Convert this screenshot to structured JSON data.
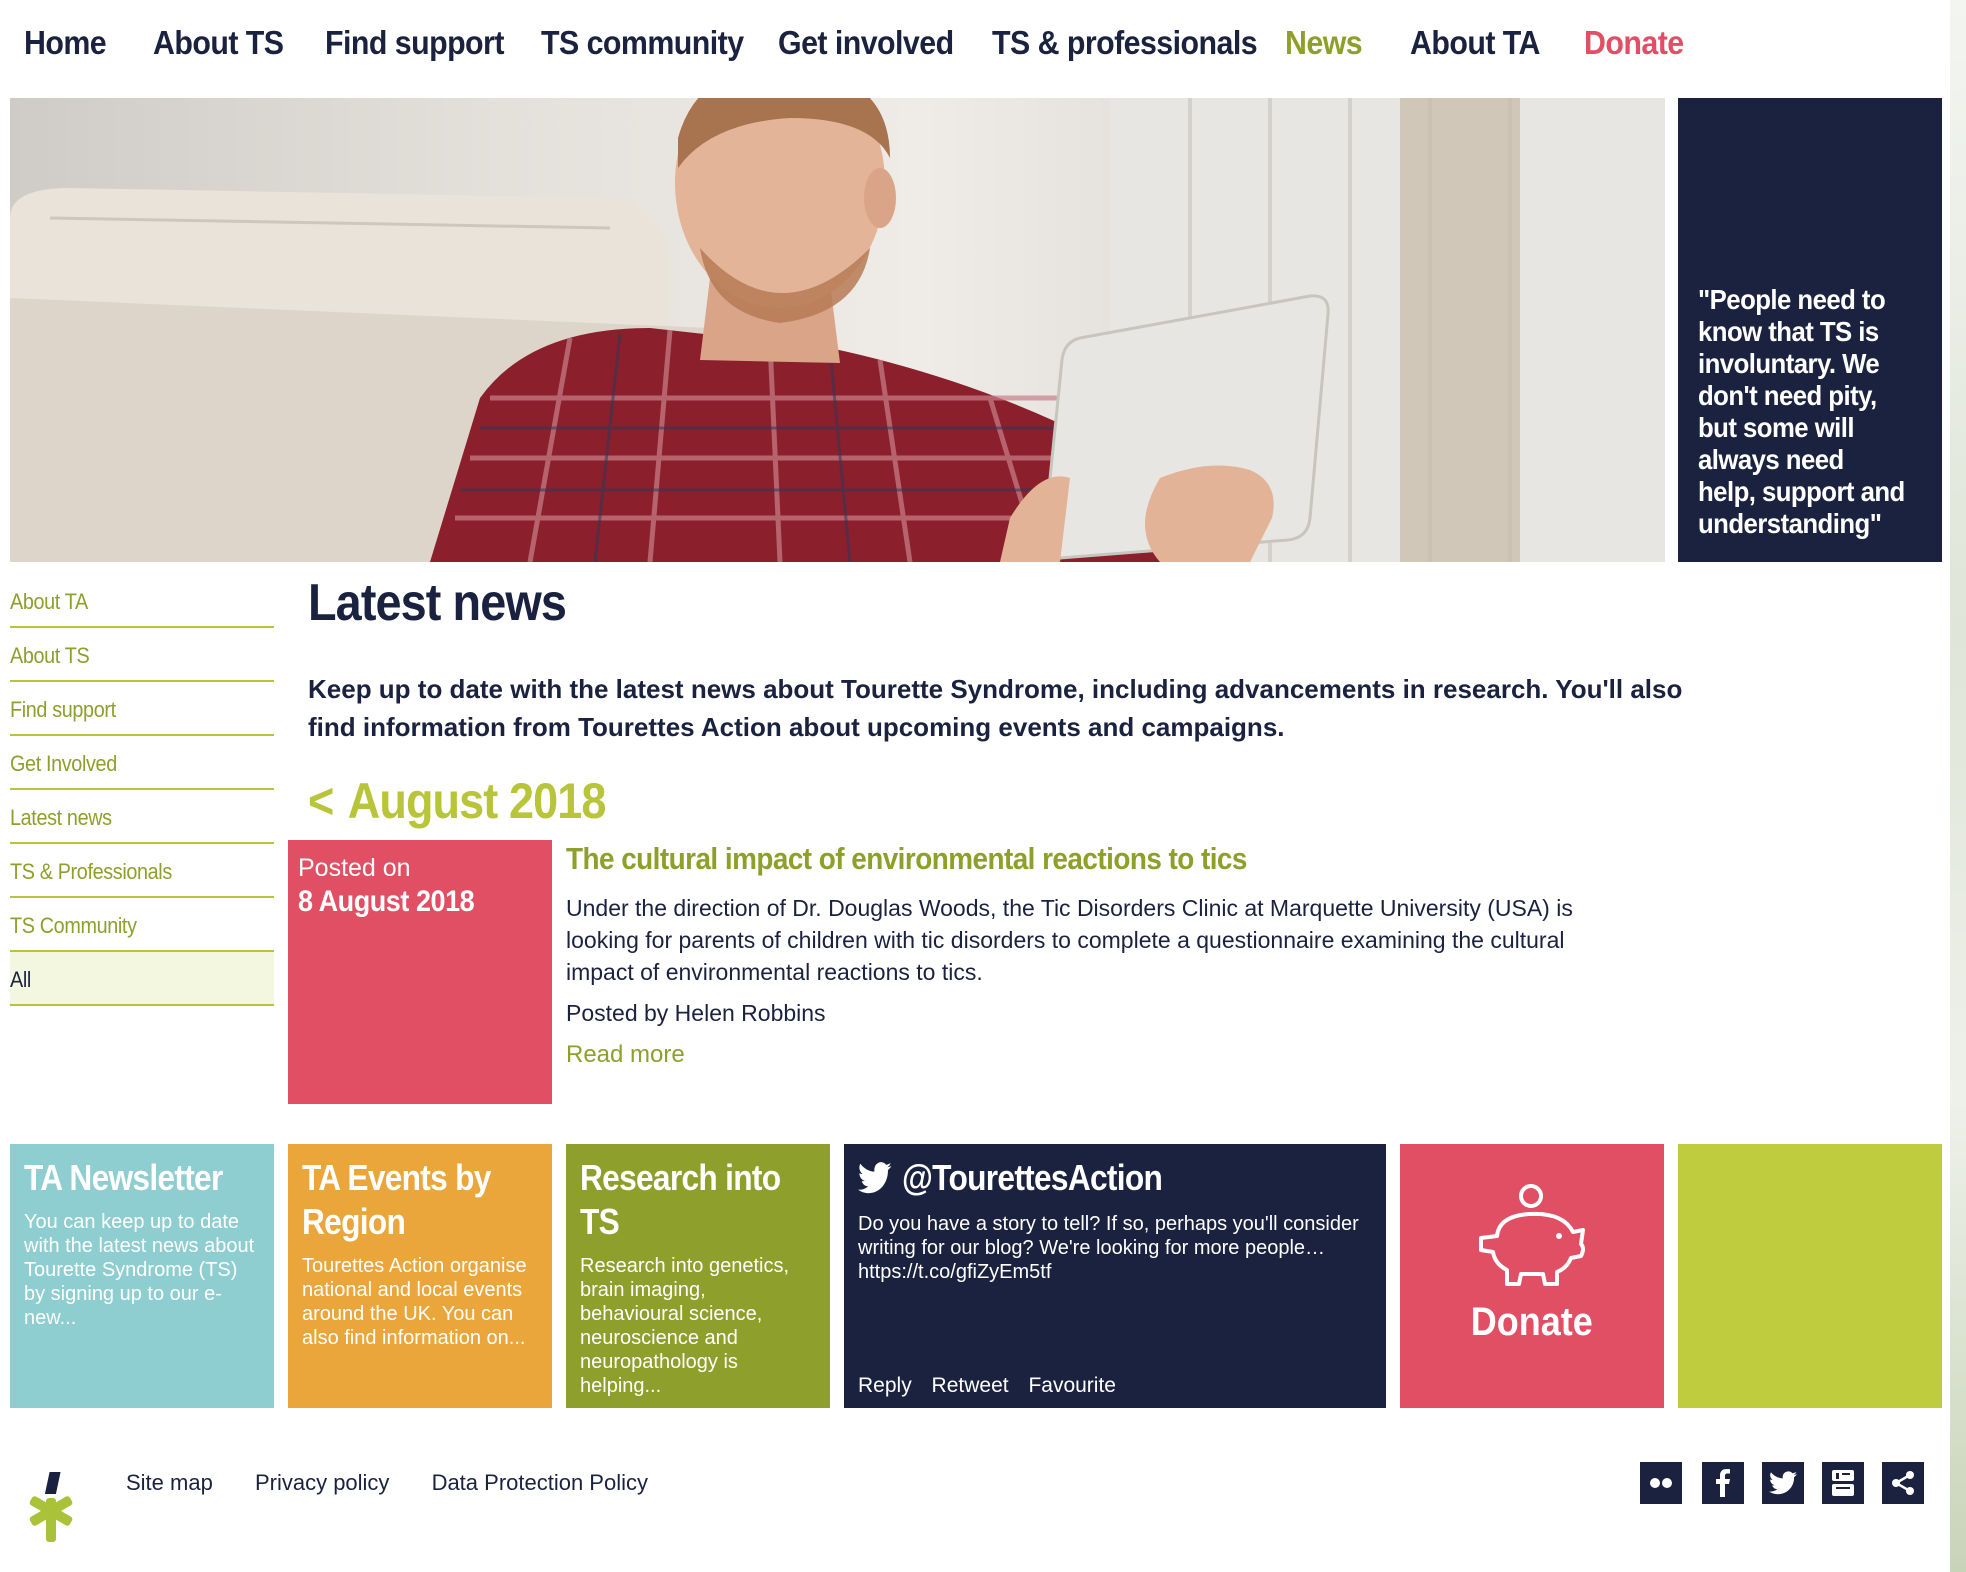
{
  "nav": {
    "items": [
      "Home",
      "About TS",
      "Find support",
      "TS community",
      "Get involved",
      "TS & professionals",
      "News",
      "About TA",
      "Donate"
    ],
    "active": "News"
  },
  "hero": {
    "quote": "\"People need to know that TS is involuntary. We don't need pity, but some will always need help, support and understanding\""
  },
  "sidebar": {
    "items": [
      "About TA",
      "About TS",
      "Find support",
      "Get Involved",
      "Latest news",
      "TS & Professionals",
      "TS Community",
      "All"
    ],
    "current": "All"
  },
  "main": {
    "title": "Latest news",
    "intro": "Keep up to date with the latest news about Tourette Syndrome, including advancements in research. You'll also find information from Tourettes Action about upcoming events and campaigns.",
    "month_prev": "<",
    "month": "August 2018"
  },
  "post": {
    "posted_on_label": "Posted on",
    "date": "8 August 2018",
    "title": "The cultural impact of environmental reactions to tics",
    "body": "Under the direction of Dr. Douglas Woods, the Tic Disorders Clinic at Marquette University (USA) is looking for parents of children with tic disorders to complete a questionnaire examining the cultural impact of environmental reactions to tics.",
    "author": "Posted by Helen Robbins",
    "read_more": "Read more"
  },
  "tiles": {
    "newsletter": {
      "title": "TA Newsletter",
      "text": "You can keep up to date with the latest news about Tourette Syndrome (TS) by signing up to our e-new..."
    },
    "events": {
      "title": "TA Events by Region",
      "text": "Tourettes Action organise national and local events around the UK. You can also find information on..."
    },
    "research": {
      "title": "Research into TS",
      "text": "Research into genetics, brain imaging, behavioural science, neuroscience and neuropathology is helping..."
    },
    "twitter": {
      "handle": "@TourettesAction",
      "tweet": "Do you have a story to tell? If so, perhaps you'll consider writing for our blog? We're looking for more people… https://t.co/gfiZyEm5tf",
      "actions": [
        "Reply",
        "Retweet",
        "Favourite"
      ],
      "icon": "twitter-bird-icon"
    },
    "donate": {
      "label": "Donate",
      "icon": "piggy-bank-icon"
    }
  },
  "footer": {
    "links": [
      "Site map",
      "Privacy policy",
      "Data Protection Policy"
    ],
    "social_icons": [
      "flickr-icon",
      "facebook-icon",
      "twitter-icon",
      "youtube-icon",
      "share-icon"
    ],
    "logo_icon": "tourettes-action-logo"
  },
  "colors": {
    "navy": "#1b2240",
    "olive": "#8f9f2c",
    "lime": "#bfcc3e",
    "pink": "#e04f63",
    "teal": "#8ecdd0",
    "orange": "#eaa63a"
  }
}
